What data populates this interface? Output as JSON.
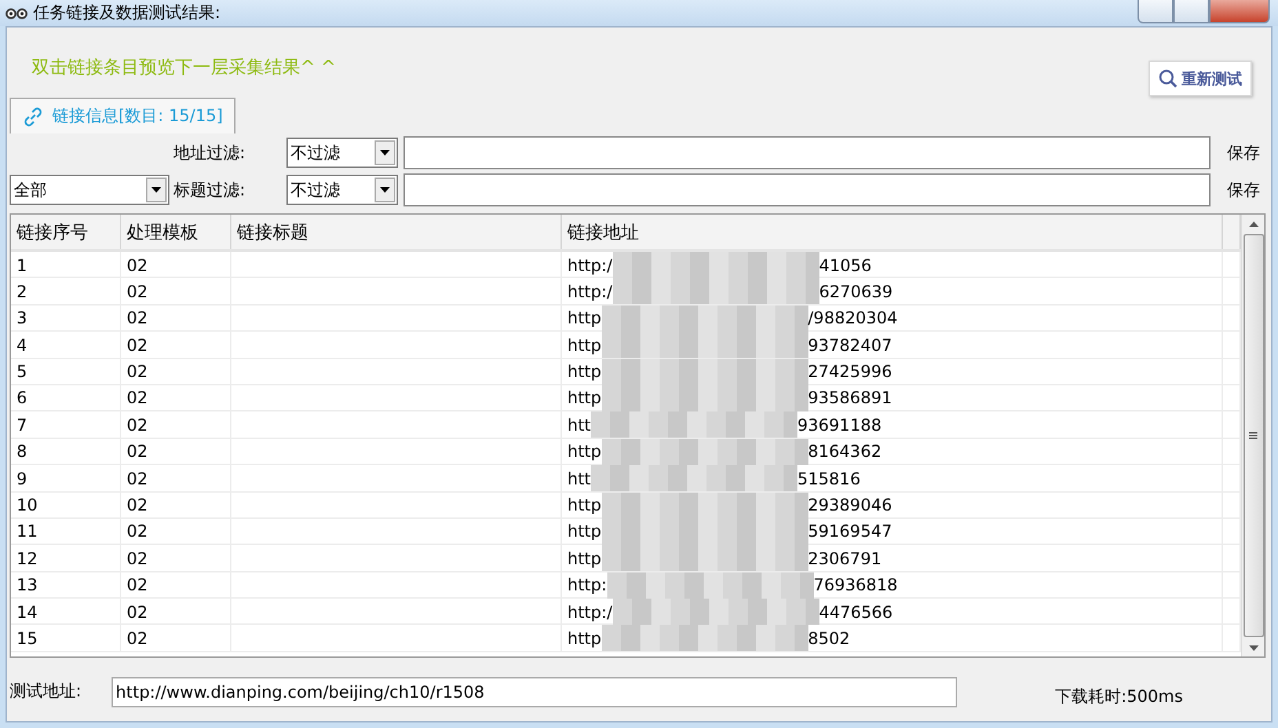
{
  "window": {
    "title": "任务链接及数据测试结果:"
  },
  "hint": "双击链接条目预览下一层采集结果^ ^",
  "retest_button": {
    "label": "重新测试"
  },
  "tabs": [
    {
      "label": "链接信息[数目: 15/15]",
      "selected": true
    }
  ],
  "scope_dropdown": {
    "value": "全部"
  },
  "filters": [
    {
      "label": "地址过滤:",
      "mode": "不过滤",
      "save": "保存"
    },
    {
      "label": "标题过滤:",
      "mode": "不过滤",
      "save": "保存"
    }
  ],
  "table": {
    "columns": [
      "链接序号",
      "处理模板",
      "链接标题",
      "链接地址"
    ],
    "rows": [
      {
        "index": "1",
        "template": "02",
        "address_start": "http:/",
        "address_end": "41056"
      },
      {
        "index": "2",
        "template": "02",
        "address_start": "http:/",
        "address_end": "6270639"
      },
      {
        "index": "3",
        "template": "02",
        "address_start": "http",
        "address_end": "/98820304"
      },
      {
        "index": "4",
        "template": "02",
        "address_start": "http",
        "address_end": "93782407"
      },
      {
        "index": "5",
        "template": "02",
        "address_start": "http",
        "address_end": "27425996"
      },
      {
        "index": "6",
        "template": "02",
        "address_start": "http",
        "address_end": "93586891"
      },
      {
        "index": "7",
        "template": "02",
        "address_start": "htt",
        "address_end": "93691188"
      },
      {
        "index": "8",
        "template": "02",
        "address_start": "http",
        "address_end": "8164362"
      },
      {
        "index": "9",
        "template": "02",
        "address_start": "htt",
        "address_end": "515816"
      },
      {
        "index": "10",
        "template": "02",
        "address_start": "http",
        "address_end": "29389046"
      },
      {
        "index": "11",
        "template": "02",
        "address_start": "http",
        "address_end": "59169547"
      },
      {
        "index": "12",
        "template": "02",
        "address_start": "http",
        "address_end": "2306791"
      },
      {
        "index": "13",
        "template": "02",
        "address_start": "http:",
        "address_end": "76936818"
      },
      {
        "index": "14",
        "template": "02",
        "address_start": "http:/",
        "address_end": "4476566"
      },
      {
        "index": "15",
        "template": "02",
        "address_start": "http",
        "address_end": "8502"
      }
    ]
  },
  "test_url": {
    "label": "测试地址:",
    "value": "http://www.dianping.com/beijing/ch10/r1508"
  },
  "download_time": "下载耗时:500ms"
}
